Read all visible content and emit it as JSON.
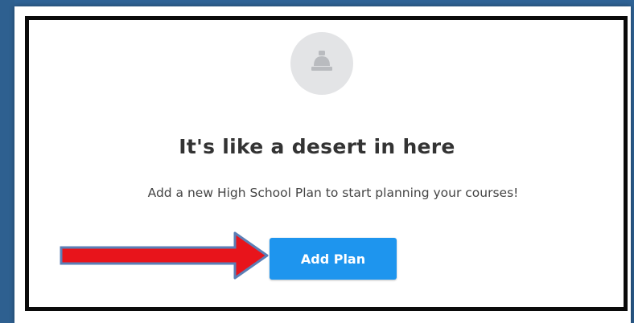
{
  "empty_state": {
    "icon": "bell-icon",
    "title": "It's like a desert in here",
    "subtitle": "Add a new High School Plan to start planning your courses!"
  },
  "actions": {
    "add_plan_label": "Add Plan"
  },
  "annotation": {
    "arrow": "red-arrow-pointing-right",
    "arrow_color": "#e8141b",
    "arrow_outline": "#5b7fb6"
  },
  "colors": {
    "primary_button": "#1e95ee",
    "frame_border": "#0a0a0a",
    "background": "#2d5e8f",
    "icon_circle": "#e3e4e6"
  }
}
